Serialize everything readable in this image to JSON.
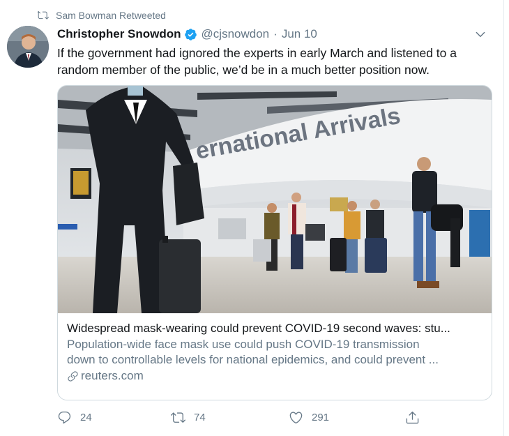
{
  "retweet_notice": {
    "text": "Sam Bowman Retweeted",
    "icon": "retweet-icon"
  },
  "author": {
    "name": "Christopher Snowdon",
    "verified": true,
    "handle": "@cjsnowdon",
    "separator": "·",
    "date": "Jun 10"
  },
  "tweet_text": [
    "If the government had ignored the experts in early March and listened to a",
    "random member of the public, we’d be in a much better position now."
  ],
  "card": {
    "image_description_icon": "photo-airport-arrivals",
    "sign_text": "ernational Arrivals",
    "title": "Widespread mask-wearing could prevent COVID-19 second waves: stu...",
    "description": [
      "Population-wide face mask use could push COVID-19 transmission",
      "down to controllable levels for national epidemics, and could prevent ..."
    ],
    "domain": "reuters.com"
  },
  "actions": {
    "reply_count": "24",
    "retweet_count": "74",
    "like_count": "291"
  },
  "colors": {
    "text": "#14171a",
    "secondary": "#657786",
    "verified": "#1da1f2",
    "border": "#cfd9de"
  }
}
